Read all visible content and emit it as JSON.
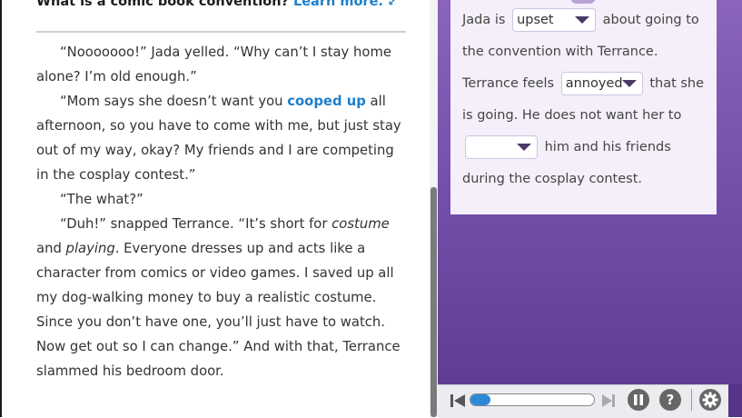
{
  "heading": {
    "title": "What is a comic book convention?",
    "link": "Learn more."
  },
  "story": {
    "p1": "“Nooooooo!” Jada yelled. “Why can’t I stay home alone? I’m old enough.”",
    "p2_before": "“Mom says she doesn’t want you ",
    "p2_vocab": "cooped up",
    "p2_after": " all afternoon, so you have to come with me, but just stay out of my way, okay? My friends and I are competing in the cosplay contest.”",
    "p3": "“The what?”",
    "p4_a": "“Duh!” snapped Terrance. “It’s short for ",
    "p4_em1": "costume",
    "p4_b": " and ",
    "p4_em2": "playing",
    "p4_c": ". Everyone dresses up and acts like a character from comics or video games. I saved up all my dog-walking money to buy a realistic costume. Since you don’t have one, you’ll just have to watch. Now get out so I can change.” And with that, Terrance slammed his bedroom door."
  },
  "question": {
    "t1": "Jada is",
    "dd1": "upset",
    "t2": "about going to the convention with Terrance. Terrance feels",
    "dd2": "annoyed",
    "t3": "that she is going. He does not want her to",
    "dd3": "",
    "t4": "him and his friends during the cosplay contest."
  },
  "player": {
    "progress": 0.16,
    "help_label": "?"
  },
  "colors": {
    "link": "#1f7fc9",
    "panel_top": "#8a64bd",
    "panel_bottom": "#5d3a91",
    "progress_fill": "#2c89d8"
  },
  "icons": {
    "external": "external-link-icon",
    "prev": "skip-previous-icon",
    "next": "skip-next-icon",
    "pause": "pause-icon",
    "help": "help-icon",
    "settings": "gear-icon"
  }
}
